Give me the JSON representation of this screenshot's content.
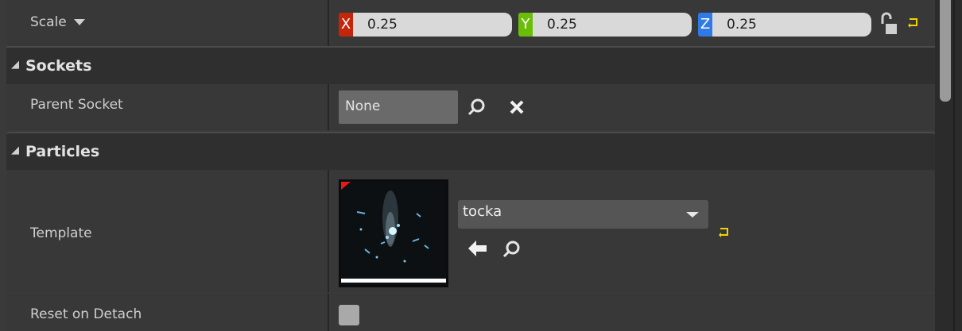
{
  "transform": {
    "scale_label": "Scale",
    "scale_dropdown_icon": "caret-down-icon",
    "x_axis": "X",
    "y_axis": "Y",
    "z_axis": "Z",
    "x_value": "0.25",
    "y_value": "0.25",
    "z_value": "0.25",
    "lock_icon": "unlocked-padlock-icon",
    "reset_icon": "reset-to-default-icon"
  },
  "sockets": {
    "title": "Sockets",
    "parent_socket_label": "Parent Socket",
    "parent_socket_value": "None",
    "browse_icon": "search-icon",
    "clear_icon": "clear-icon"
  },
  "particles": {
    "title": "Particles",
    "template_label": "Template",
    "template_value": "tocka",
    "use_selected_icon": "arrow-left-icon",
    "browse_icon": "search-icon",
    "reset_icon": "reset-to-default-icon",
    "reset_on_detach_label": "Reset on Detach",
    "reset_on_detach_checked": false
  },
  "colors": {
    "x_axis": "#c4260b",
    "y_axis": "#6abe0a",
    "z_axis": "#2f7ae5",
    "reset_arrow": "#f0d400",
    "thumbnail_corner": "#e81818"
  }
}
